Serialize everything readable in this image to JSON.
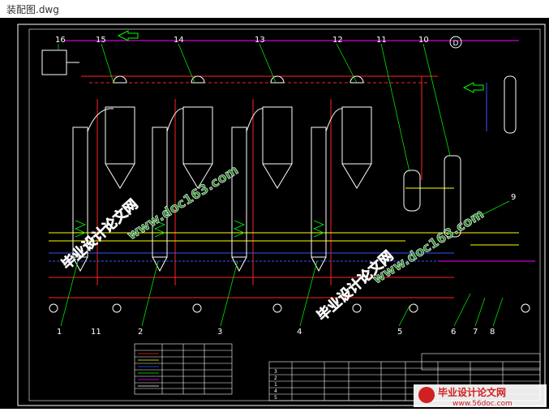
{
  "window": {
    "title": "装配图.dwg"
  },
  "drawing": {
    "callouts_top": [
      "16",
      "15",
      "14",
      "13",
      "12",
      "11",
      "10"
    ],
    "callouts_bottom": [
      "1",
      "11",
      "2",
      "3",
      "4",
      "5",
      "6",
      "7",
      "8"
    ],
    "callout_right": "9",
    "vessel_labels": [
      "1",
      "2",
      "3",
      "4",
      "5"
    ],
    "motor_label": "D"
  },
  "watermarks": {
    "site_cn": "毕业设计论文网",
    "site_url": "www.doc163.com",
    "footer_url": "www.56doc.com"
  },
  "colors": {
    "background": "#000000",
    "frame": "#ffffff",
    "callout": "#ffffff",
    "vessel": "#ffffff",
    "steam_line": "#ff2222",
    "water_line": "#ffff00",
    "vacuum_line": "#3355ff",
    "leader": "#00ff00",
    "magenta": "#ff00ff",
    "watermark_red": "#e02020",
    "watermark_green": "#2a8a2a"
  }
}
